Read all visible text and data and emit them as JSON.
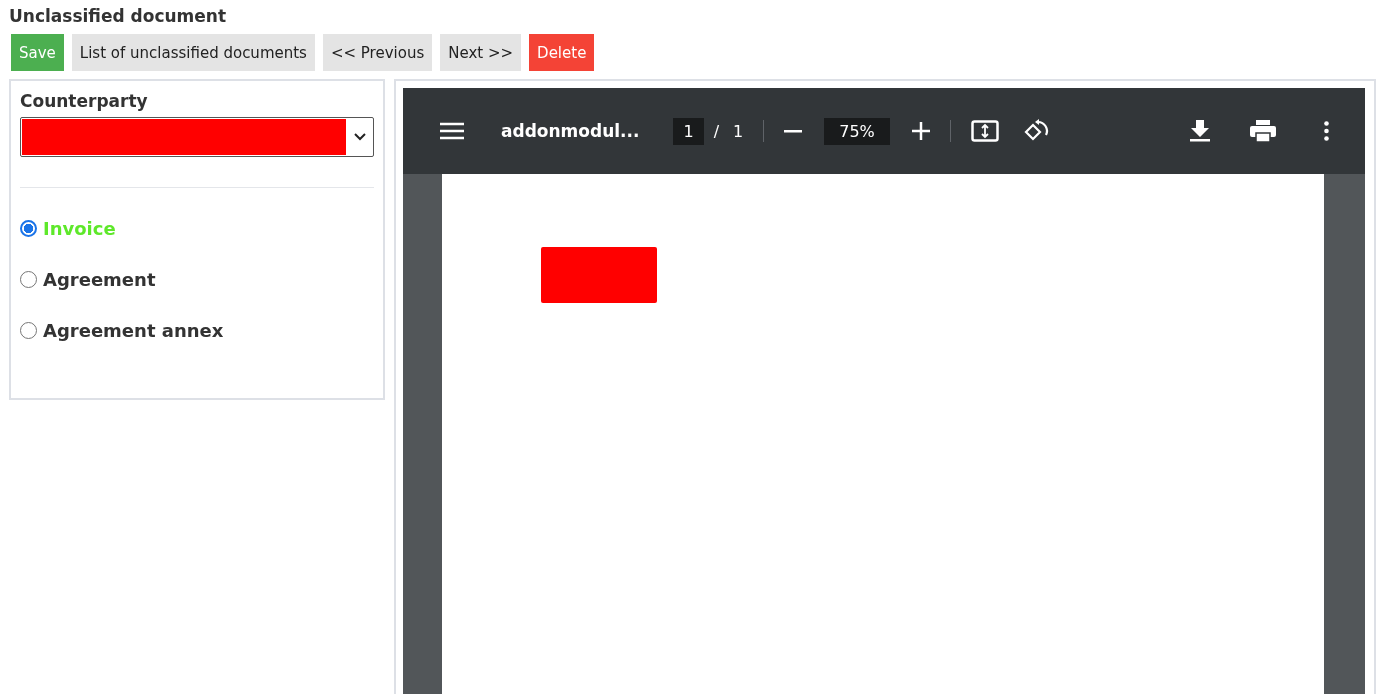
{
  "page_title": "Unclassified document",
  "buttons": [
    {
      "label": "Save",
      "kind": "success"
    },
    {
      "label": "List of unclassified documents",
      "kind": "default"
    },
    {
      "label": "<< Previous",
      "kind": "default"
    },
    {
      "label": "Next >>",
      "kind": "default"
    },
    {
      "label": "Delete",
      "kind": "danger"
    }
  ],
  "counterparty": {
    "label": "Counterparty"
  },
  "document_types": [
    {
      "label": "Invoice",
      "selected": true
    },
    {
      "label": "Agreement",
      "selected": false
    },
    {
      "label": "Agreement annex",
      "selected": false
    }
  ],
  "pdf_viewer": {
    "file_name": "addonmodul...",
    "page": "1",
    "page_separator": "/",
    "page_count": "1",
    "zoom": "75%"
  }
}
